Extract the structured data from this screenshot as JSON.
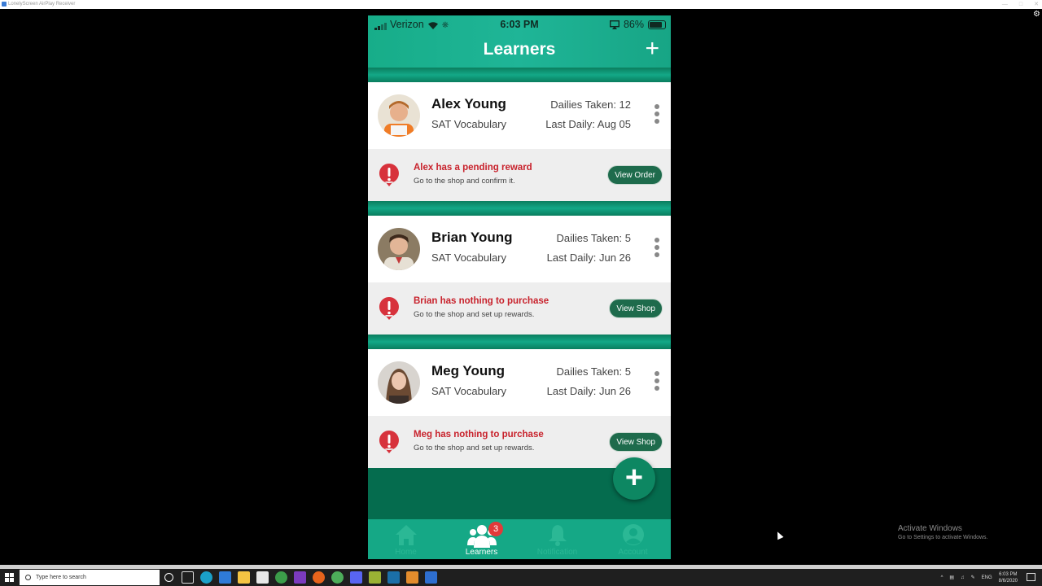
{
  "window": {
    "title": "LonelyScreen AirPlay Receiver"
  },
  "status_bar": {
    "carrier": "Verizon",
    "time": "6:03 PM",
    "battery": "86%"
  },
  "header": {
    "title": "Learners",
    "add_label": "+"
  },
  "learners": [
    {
      "name": "Alex Young",
      "subject": "SAT Vocabulary",
      "dailies": "Dailies Taken: 12",
      "last_daily": "Last Daily: Aug 05",
      "notice_title": "Alex has a pending reward",
      "notice_sub": "Go to the shop and confirm it.",
      "action": "View Order"
    },
    {
      "name": "Brian Young",
      "subject": "SAT Vocabulary",
      "dailies": "Dailies Taken: 5",
      "last_daily": "Last Daily: Jun 26",
      "notice_title": "Brian has nothing to purchase",
      "notice_sub": "Go to the shop and set up rewards.",
      "action": "View Shop"
    },
    {
      "name": "Meg Young",
      "subject": "SAT Vocabulary",
      "dailies": "Dailies Taken: 5",
      "last_daily": "Last Daily: Jun 26",
      "notice_title": "Meg has nothing to purchase",
      "notice_sub": "Go to the shop and set up rewards.",
      "action": "View Shop"
    }
  ],
  "fab": {
    "label": "+"
  },
  "tabs": [
    {
      "label": "Home",
      "icon": "home-icon"
    },
    {
      "label": "Learners",
      "icon": "users-icon",
      "badge": "3"
    },
    {
      "label": "Notification",
      "icon": "bell-icon"
    },
    {
      "label": "Account",
      "icon": "account-icon"
    }
  ],
  "watermark": {
    "line1": "Activate Windows",
    "line2": "Go to Settings to activate Windows."
  },
  "taskbar": {
    "search_placeholder": "Type here to search",
    "lang": "ENG",
    "time": "6:03 PM",
    "date": "8/6/2020"
  },
  "colors": {
    "header": "#1fb597",
    "background": "#056c4e",
    "button": "#1e6b4c",
    "alert": "#c8222c",
    "badge": "#e23a3a"
  }
}
